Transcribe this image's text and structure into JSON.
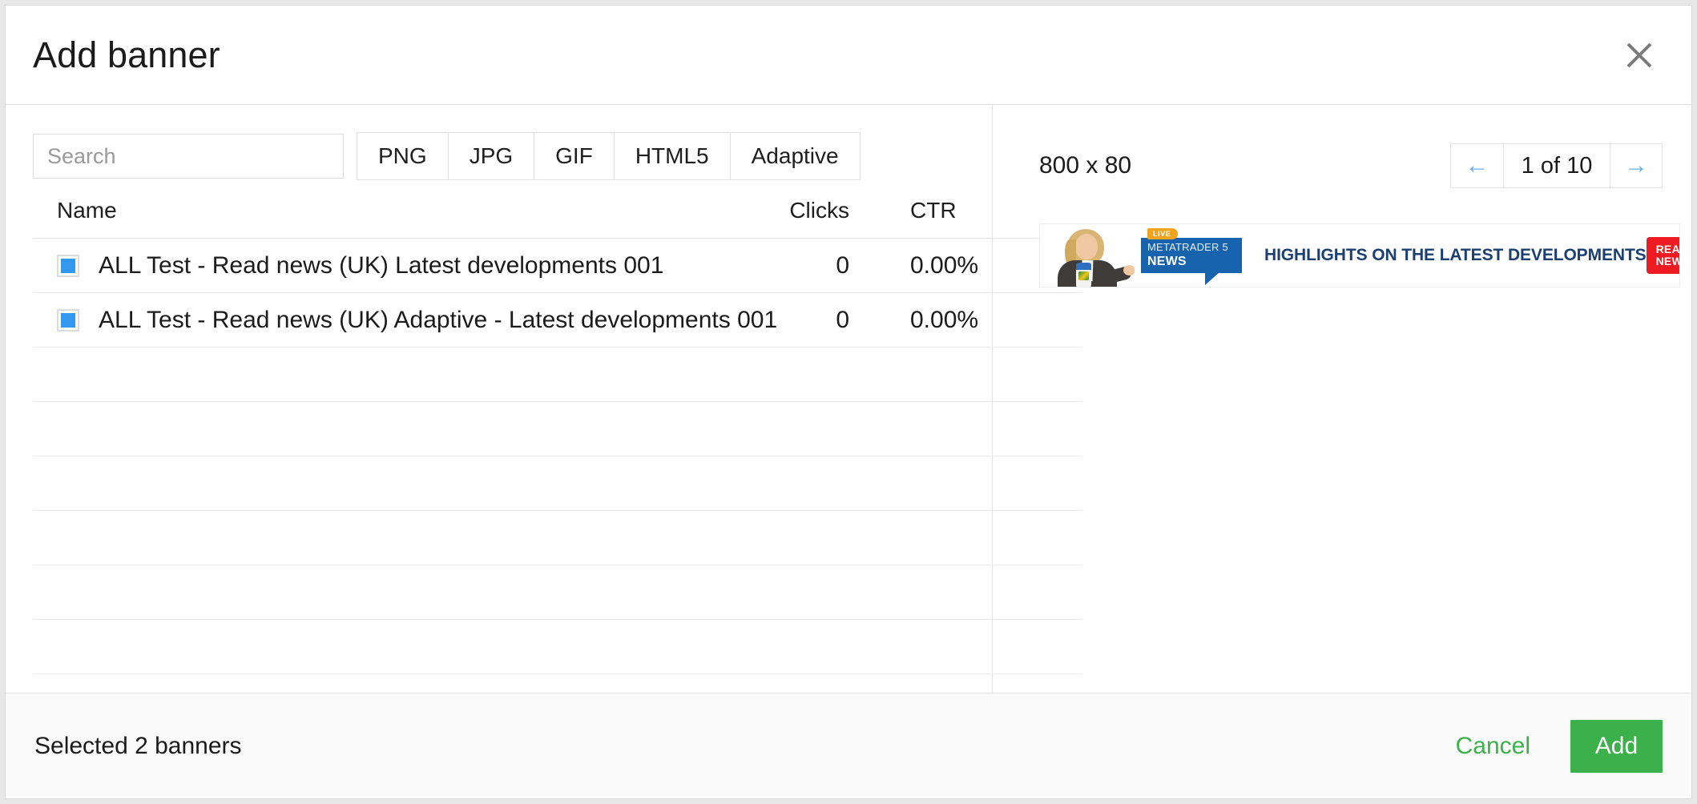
{
  "dialog": {
    "title": "Add banner",
    "close_icon": "close-icon"
  },
  "search": {
    "placeholder": "Search",
    "value": ""
  },
  "filters": [
    {
      "label": "PNG",
      "active": false
    },
    {
      "label": "JPG",
      "active": false
    },
    {
      "label": "GIF",
      "active": false
    },
    {
      "label": "HTML5",
      "active": false
    },
    {
      "label": "Adaptive",
      "active": false
    }
  ],
  "table": {
    "columns": [
      "Name",
      "Clicks",
      "CTR"
    ],
    "rows": [
      {
        "checked": true,
        "name": "ALL Test - Read news (UK)  Latest developments 001",
        "clicks": "0",
        "ctr": "0.00%"
      },
      {
        "checked": true,
        "name": "ALL Test - Read news (UK) Adaptive -  Latest developments 001",
        "clicks": "0",
        "ctr": "0.00%"
      }
    ],
    "empty_row_count": 6
  },
  "preview": {
    "size_label": "800 x 80",
    "pager": {
      "prev_icon": "arrow-left-icon",
      "prev_label": "←",
      "page_label": "1 of 10",
      "next_icon": "arrow-right-icon",
      "next_label": "→"
    },
    "banner": {
      "live_badge": "LIVE",
      "brand_line1": "METATRADER 5",
      "brand_line2": "NEWS",
      "headline": "HIGHLIGHTS ON THE LATEST DEVELOPMENTS",
      "cta_line1": "READ",
      "cta_line2": "NEWS",
      "cta_arrow": "»",
      "colors": {
        "brand_blue": "#1763ad",
        "live_amber": "#f0a41e",
        "headline_navy": "#1c3f72",
        "cta_red": "#ee1b22"
      }
    }
  },
  "footer": {
    "selected_text": "Selected 2 banners",
    "cancel_label": "Cancel",
    "add_label": "Add"
  },
  "theme": {
    "accent_green": "#3cb14b",
    "checkbox_blue": "#3399ee",
    "pager_blue": "#69aff0"
  }
}
